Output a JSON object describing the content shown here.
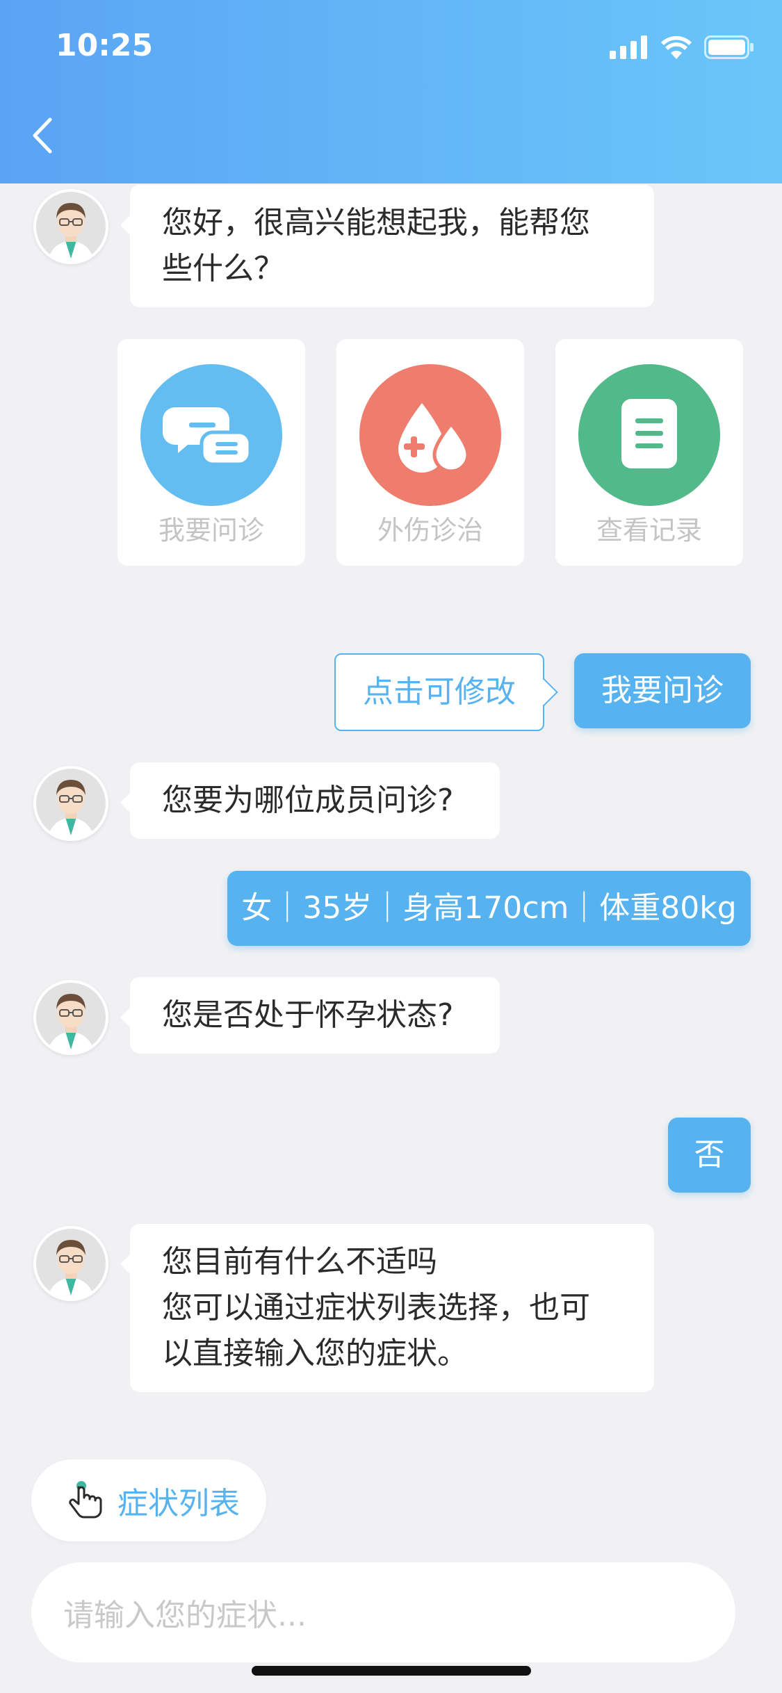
{
  "status_bar": {
    "time": "10:25"
  },
  "colors": {
    "accent": "#56b3ef",
    "header_start": "#5aa4f4",
    "header_end": "#6ac6f9",
    "consult": "#63bdf0",
    "injury": "#ee7d6e",
    "records": "#52b98a"
  },
  "messages": {
    "greeting": [
      "您好，很高兴能想起我，能帮您",
      "些什么？"
    ],
    "ask_member": "您要为哪位成员问诊?",
    "ask_pregnant": "您是否处于怀孕状态?",
    "ask_symptoms": [
      "您目前有什么不适吗",
      "您可以通过症状列表选择，也可",
      "以直接输入您的症状。"
    ]
  },
  "options": [
    {
      "label": "我要问诊",
      "icon": "chat-bubbles-icon"
    },
    {
      "label": "外伤诊治",
      "icon": "blood-drop-icon"
    },
    {
      "label": "查看记录",
      "icon": "document-icon"
    }
  ],
  "replies": {
    "edit_hint": "点击可修改",
    "consult": "我要问诊",
    "member_info": "女｜35岁｜身高170cm｜体重80kg",
    "pregnant_answer": "否"
  },
  "symptom_list_button": "症状列表",
  "input": {
    "placeholder": "请输入您的症状..."
  }
}
